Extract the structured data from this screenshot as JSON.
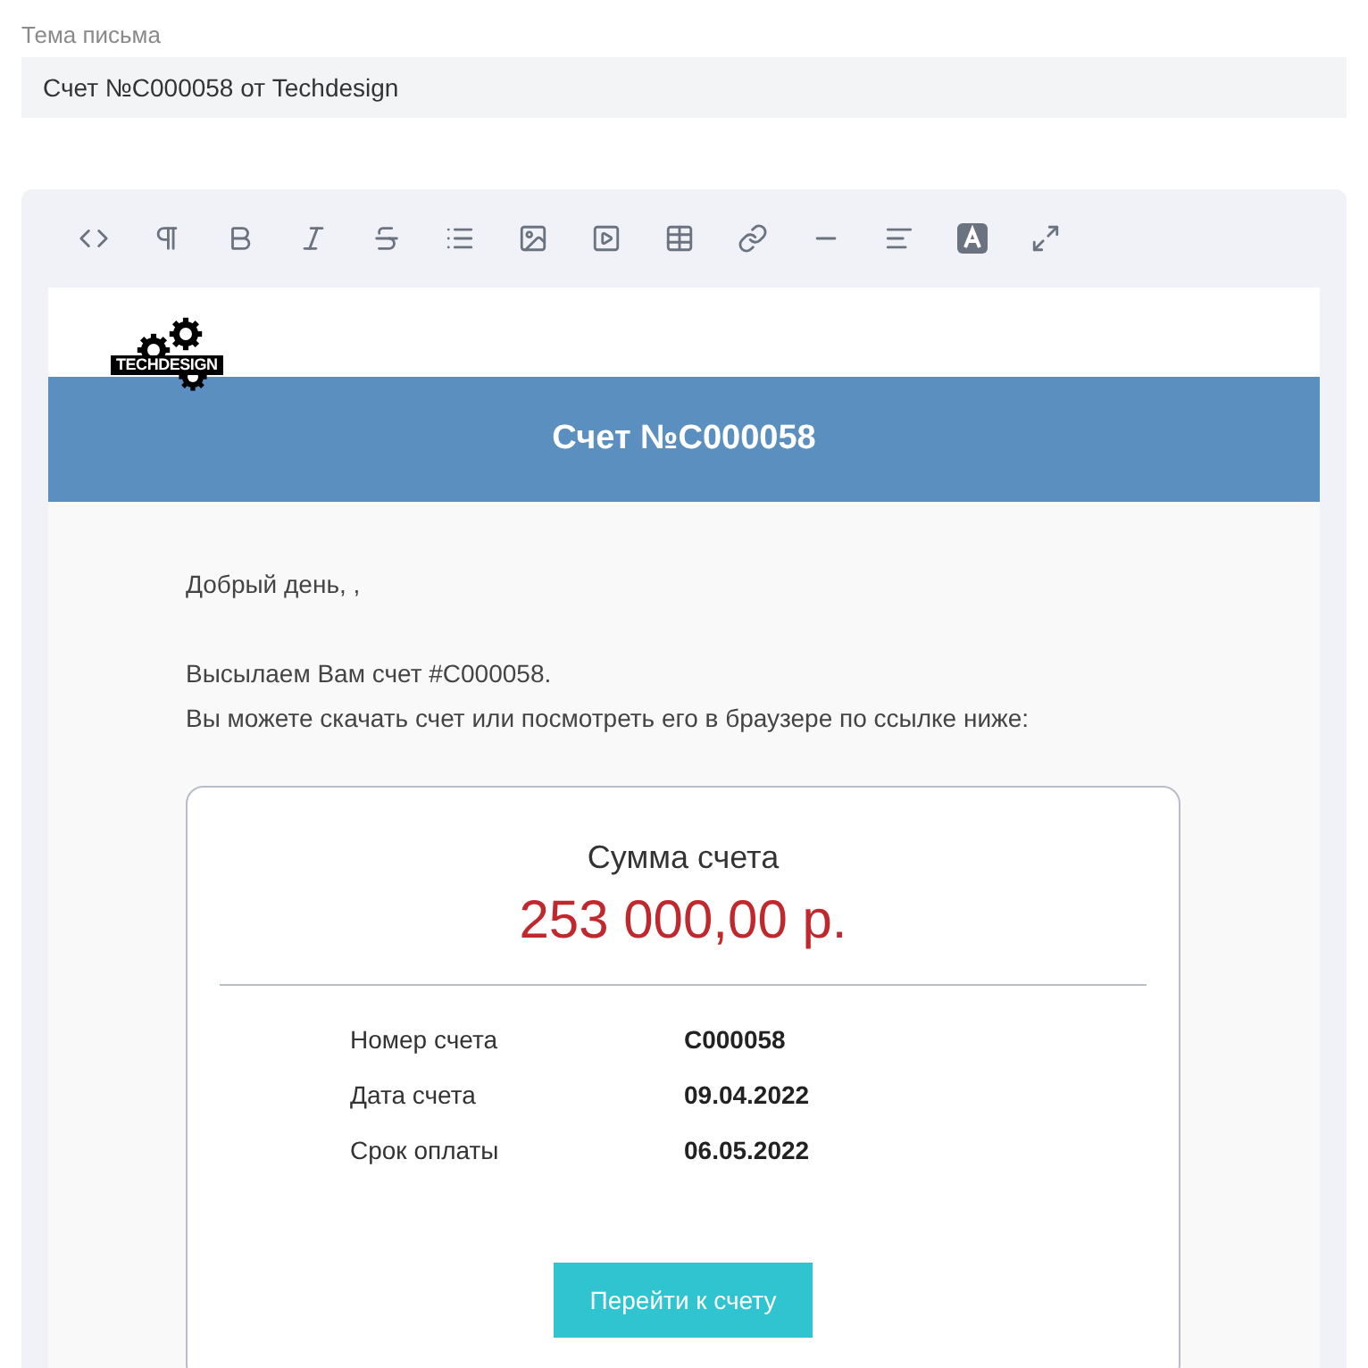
{
  "subject": {
    "label": "Тема письма",
    "value": "Счет №C000058 от Techdesign"
  },
  "email": {
    "logo_text": "TECHDESIGN",
    "header_title": "Счет №C000058",
    "paragraphs": [
      "Добрый день, ,",
      "Высылаем Вам счет #C000058.",
      "Вы можете скачать счет или посмотреть его в браузере по ссылке ниже:"
    ],
    "card": {
      "amount_label": "Сумма счета",
      "amount": "253 000,00 р.",
      "details": [
        {
          "label": "Номер счета",
          "value": "C000058"
        },
        {
          "label": "Дата счета",
          "value": "09.04.2022"
        },
        {
          "label": "Срок оплаты",
          "value": "06.05.2022"
        }
      ],
      "button": "Перейти к счету"
    }
  }
}
